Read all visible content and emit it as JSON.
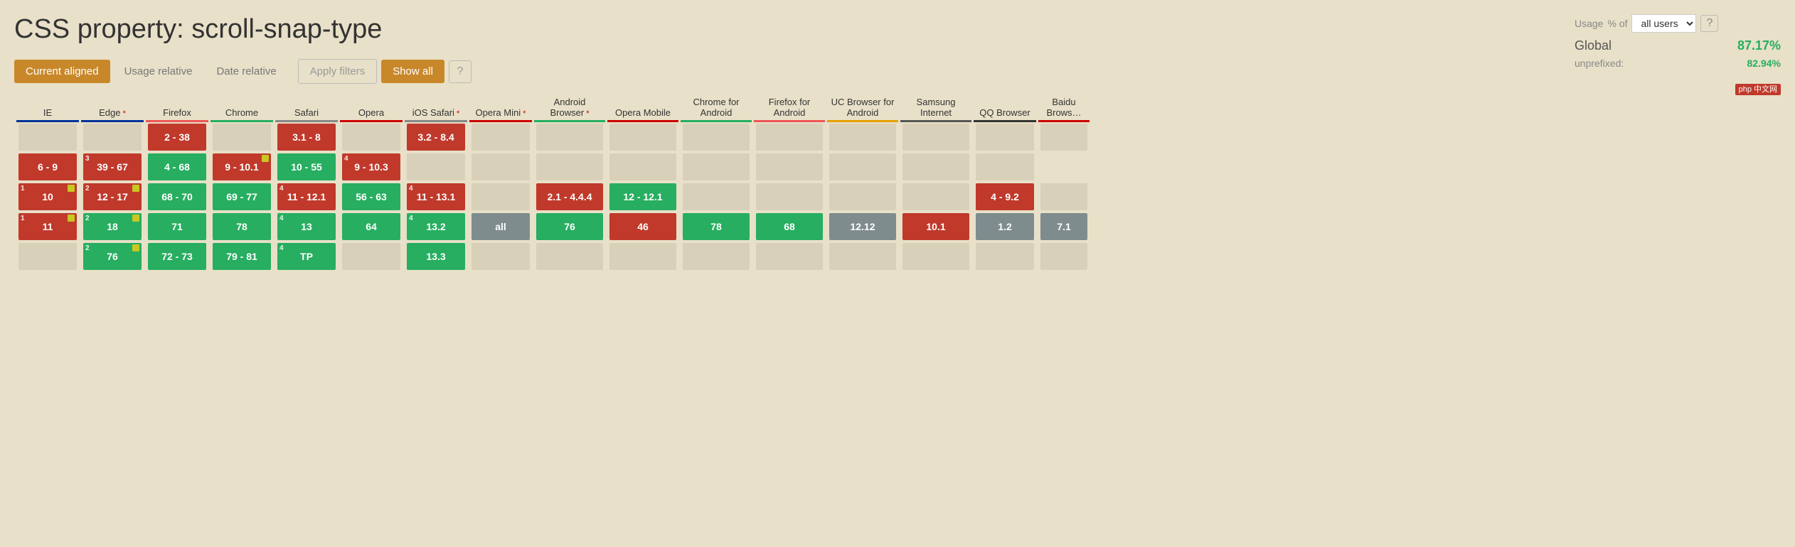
{
  "title": "CSS property: scroll-snap-type",
  "usage": {
    "label": "Usage",
    "percent_of": "% of",
    "select_value": "all users",
    "global_label": "Global",
    "global_value": "87.17%",
    "unprefixed_label": "unprefixed:",
    "unprefixed_value": "82.94%"
  },
  "filters": {
    "current_aligned": "Current aligned",
    "usage_relative": "Usage relative",
    "date_relative": "Date relative",
    "apply_filters": "Apply filters",
    "show_all": "Show all",
    "help": "?"
  },
  "browsers": [
    {
      "id": "ie",
      "label": "IE",
      "star": false,
      "underline": "#003399"
    },
    {
      "id": "edge",
      "label": "Edge",
      "star": true,
      "underline": "#003399"
    },
    {
      "id": "firefox",
      "label": "Firefox",
      "star": false,
      "underline": "#e55"
    },
    {
      "id": "chrome",
      "label": "Chrome",
      "star": false,
      "underline": "#27ae60"
    },
    {
      "id": "safari",
      "label": "Safari",
      "star": false,
      "underline": "#888"
    },
    {
      "id": "opera",
      "label": "Opera",
      "star": false,
      "underline": "#c00"
    },
    {
      "id": "ios",
      "label": "iOS Safari",
      "star": true,
      "underline": "#888"
    },
    {
      "id": "opera-mini",
      "label": "Opera Mini",
      "star": true,
      "underline": "#c00"
    },
    {
      "id": "android",
      "label": "Android Browser",
      "star": true,
      "underline": "#27ae60"
    },
    {
      "id": "opera-mobile",
      "label": "Opera Mobile",
      "star": false,
      "underline": "#c00"
    },
    {
      "id": "chrome-android",
      "label": "Chrome for Android",
      "star": false,
      "underline": "#27ae60"
    },
    {
      "id": "firefox-android",
      "label": "Firefox for Android",
      "star": false,
      "underline": "#e55"
    },
    {
      "id": "uc",
      "label": "UC Browser for Android",
      "star": false,
      "underline": "#e5a000"
    },
    {
      "id": "samsung",
      "label": "Samsung Internet",
      "star": false,
      "underline": "#555"
    },
    {
      "id": "qq",
      "label": "QQ Browser",
      "star": false,
      "underline": "#333"
    },
    {
      "id": "baidu",
      "label": "Baidu Brows…",
      "star": false,
      "underline": "#c00"
    }
  ],
  "php_badge": "php 中文网"
}
